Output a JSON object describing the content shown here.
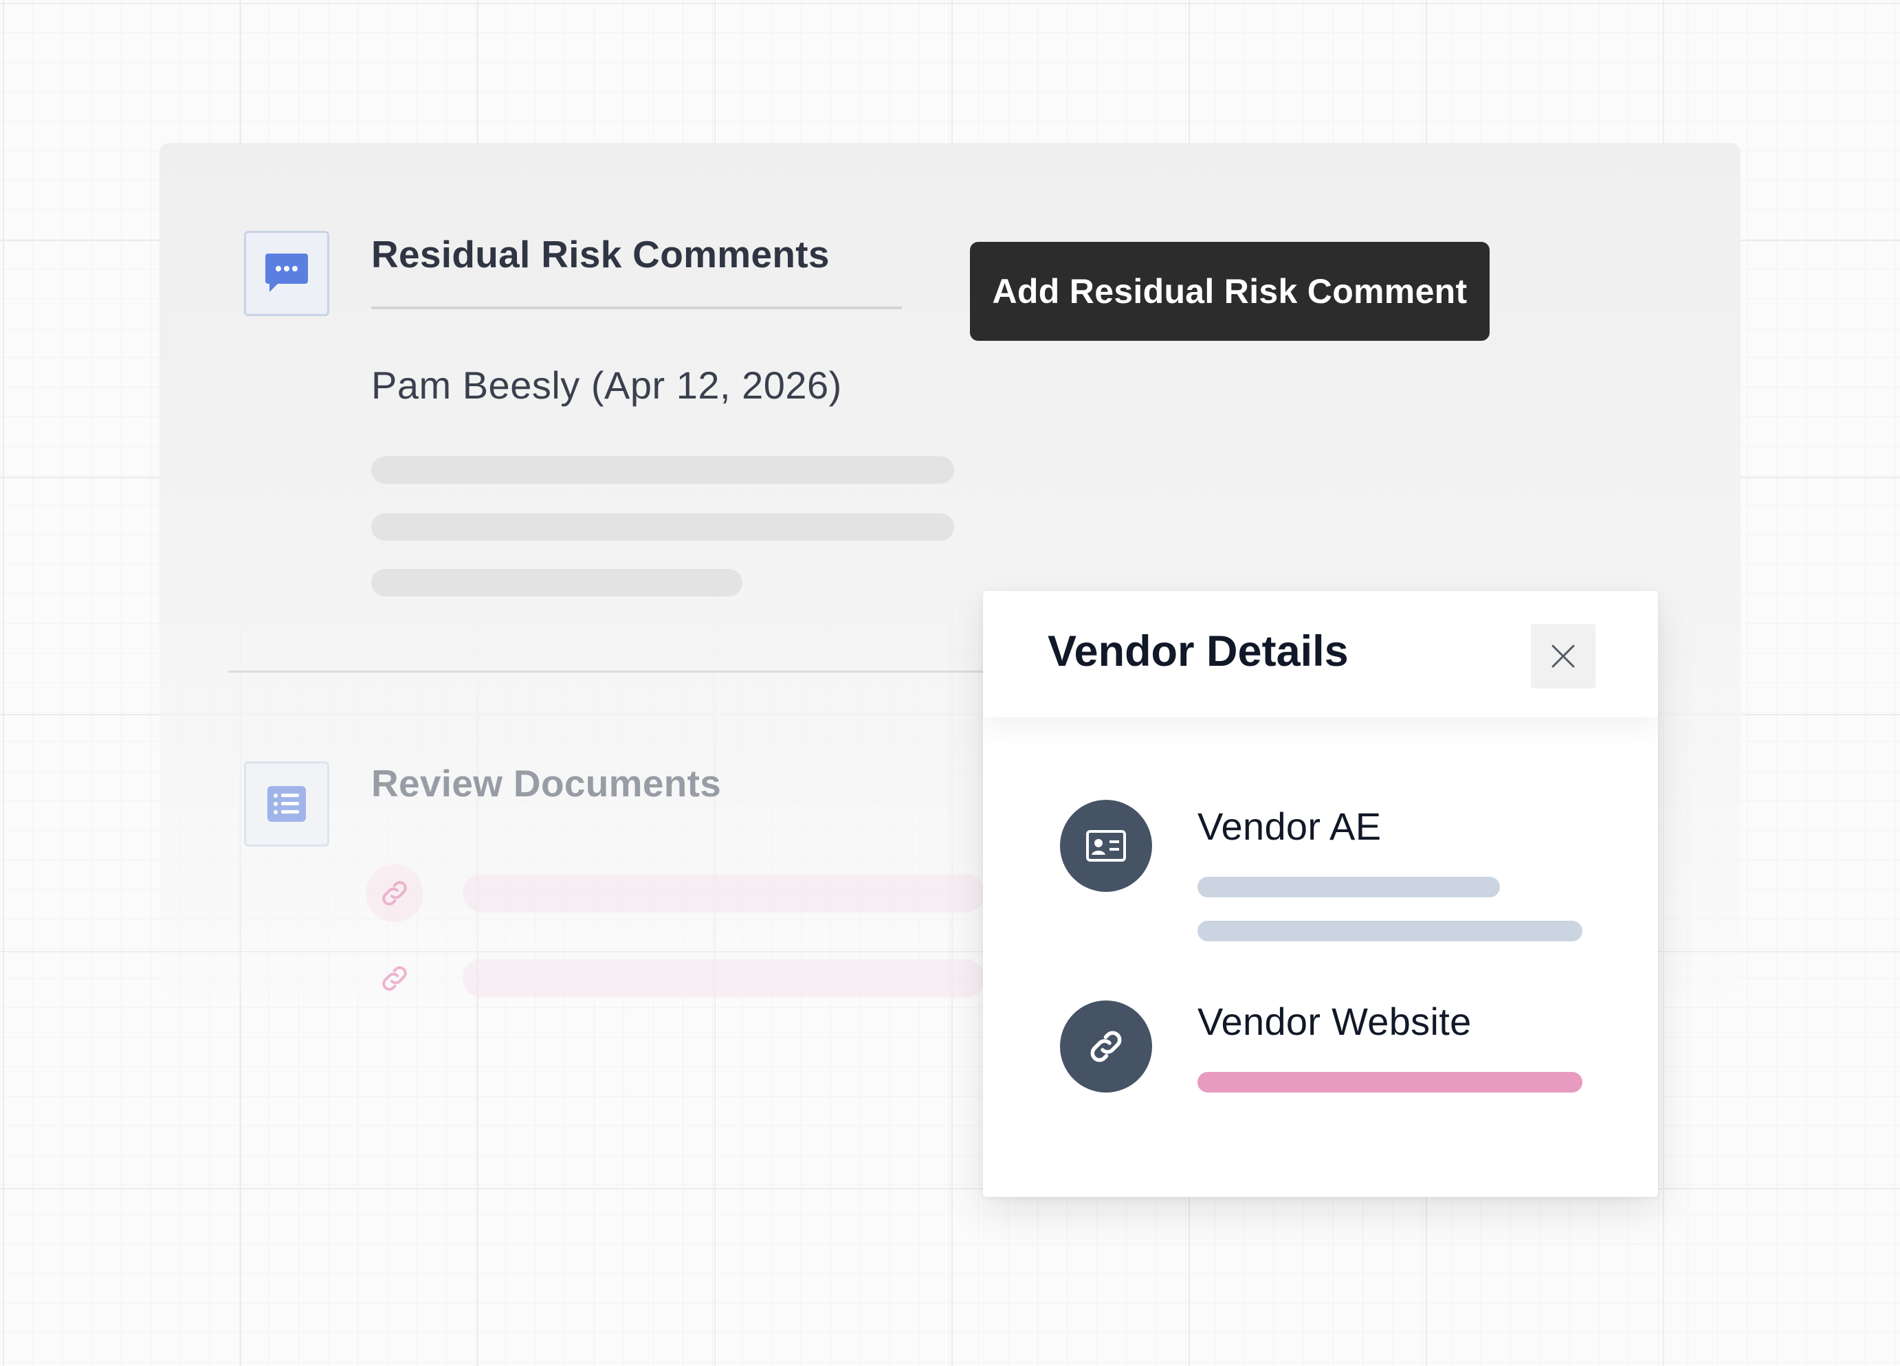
{
  "comments_section": {
    "title": "Residual Risk Comments",
    "author_line": "Pam Beesly (Apr 12, 2026)",
    "add_button_label": "Add Residual Risk Comment",
    "icon": "comment-dots-icon"
  },
  "documents_section": {
    "title": "Review Documents",
    "icon": "list-icon",
    "link_icon": "link-icon"
  },
  "vendor_panel": {
    "title": "Vendor Details",
    "close_icon": "close-icon",
    "items": [
      {
        "label": "Vendor AE",
        "icon": "id-card-icon"
      },
      {
        "label": "Vendor Website",
        "icon": "link-icon"
      }
    ]
  },
  "colors": {
    "accent_blue": "#5b7fe0",
    "button_dark": "#2c2c2c",
    "pink_link": "#e89bc0",
    "icon_circle": "#465365"
  }
}
